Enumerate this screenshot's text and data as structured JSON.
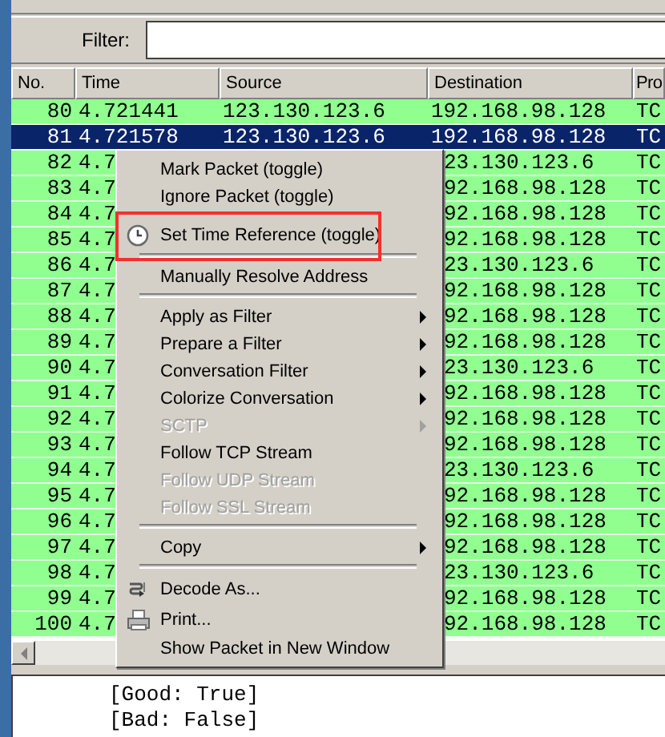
{
  "filter": {
    "label": "Filter:"
  },
  "packet_list": {
    "columns": [
      "No.",
      "Time",
      "Source",
      "Destination",
      "Pro"
    ],
    "rows": [
      {
        "no": "80",
        "time": "4.721441",
        "source": "123.130.123.6",
        "destination": "192.168.98.128",
        "protocol": "TC",
        "selected": false
      },
      {
        "no": "81",
        "time": "4.721578",
        "source": "123.130.123.6",
        "destination": "192.168.98.128",
        "protocol": "TC",
        "selected": true
      },
      {
        "no": "82",
        "time": "4.7",
        "destination": "23.130.123.6",
        "protocol": "TC",
        "selected": false
      },
      {
        "no": "83",
        "time": "4.7",
        "destination": "92.168.98.128",
        "protocol": "TC",
        "selected": false
      },
      {
        "no": "84",
        "time": "4.7",
        "destination": "92.168.98.128",
        "protocol": "TC",
        "selected": false
      },
      {
        "no": "85",
        "time": "4.7",
        "destination": "92.168.98.128",
        "protocol": "TC",
        "selected": false
      },
      {
        "no": "86",
        "time": "4.7",
        "destination": "23.130.123.6",
        "protocol": "TC",
        "selected": false
      },
      {
        "no": "87",
        "time": "4.7",
        "destination": "92.168.98.128",
        "protocol": "TC",
        "selected": false
      },
      {
        "no": "88",
        "time": "4.7",
        "destination": "92.168.98.128",
        "protocol": "TC",
        "selected": false
      },
      {
        "no": "89",
        "time": "4.7",
        "destination": "92.168.98.128",
        "protocol": "TC",
        "selected": false
      },
      {
        "no": "90",
        "time": "4.7",
        "destination": "23.130.123.6",
        "protocol": "TC",
        "selected": false
      },
      {
        "no": "91",
        "time": "4.7",
        "destination": "92.168.98.128",
        "protocol": "TC",
        "selected": false
      },
      {
        "no": "92",
        "time": "4.7",
        "destination": "92.168.98.128",
        "protocol": "TC",
        "selected": false
      },
      {
        "no": "93",
        "time": "4.7",
        "destination": "92.168.98.128",
        "protocol": "TC",
        "selected": false
      },
      {
        "no": "94",
        "time": "4.7",
        "destination": "23.130.123.6",
        "protocol": "TC",
        "selected": false
      },
      {
        "no": "95",
        "time": "4.7",
        "destination": "92.168.98.128",
        "protocol": "TC",
        "selected": false
      },
      {
        "no": "96",
        "time": "4.7",
        "destination": "92.168.98.128",
        "protocol": "TC",
        "selected": false
      },
      {
        "no": "97",
        "time": "4.7",
        "destination": "92.168.98.128",
        "protocol": "TC",
        "selected": false
      },
      {
        "no": "98",
        "time": "4.7",
        "destination": "23.130.123.6",
        "protocol": "TC",
        "selected": false
      },
      {
        "no": "99",
        "time": "4.7",
        "destination": "92.168.98.128",
        "protocol": "TC",
        "selected": false
      },
      {
        "no": "100",
        "time": "4.7",
        "destination": "92.168.98.128",
        "protocol": "TC",
        "selected": false
      }
    ]
  },
  "context_menu": {
    "items": [
      {
        "kind": "item",
        "label": "Mark Packet (toggle)",
        "disabled": false
      },
      {
        "kind": "item",
        "label": "Ignore Packet (toggle)",
        "disabled": false
      },
      {
        "kind": "timeref",
        "label": "Set Time Reference (toggle)",
        "highlighted": true,
        "disabled": false
      },
      {
        "kind": "separator"
      },
      {
        "kind": "item",
        "label": "Manually Resolve Address",
        "disabled": false
      },
      {
        "kind": "separator"
      },
      {
        "kind": "submenu",
        "label": "Apply as Filter",
        "disabled": false
      },
      {
        "kind": "submenu",
        "label": "Prepare a Filter",
        "disabled": false
      },
      {
        "kind": "submenu",
        "label": "Conversation Filter",
        "disabled": false
      },
      {
        "kind": "submenu",
        "label": "Colorize Conversation",
        "disabled": false
      },
      {
        "kind": "submenu",
        "label": "SCTP",
        "disabled": true
      },
      {
        "kind": "item",
        "label": "Follow TCP Stream",
        "disabled": false
      },
      {
        "kind": "item",
        "label": "Follow UDP Stream",
        "disabled": true
      },
      {
        "kind": "item",
        "label": "Follow SSL Stream",
        "disabled": true
      },
      {
        "kind": "separator"
      },
      {
        "kind": "submenu",
        "label": "Copy",
        "disabled": false
      },
      {
        "kind": "separator"
      },
      {
        "kind": "decode",
        "label": "Decode As...",
        "disabled": false
      },
      {
        "kind": "print",
        "label": "Print...",
        "disabled": false
      },
      {
        "kind": "item",
        "label": "Show Packet in New Window",
        "disabled": false
      }
    ]
  },
  "details": {
    "lines": [
      "[Good: True]",
      "[Bad: False]"
    ]
  }
}
